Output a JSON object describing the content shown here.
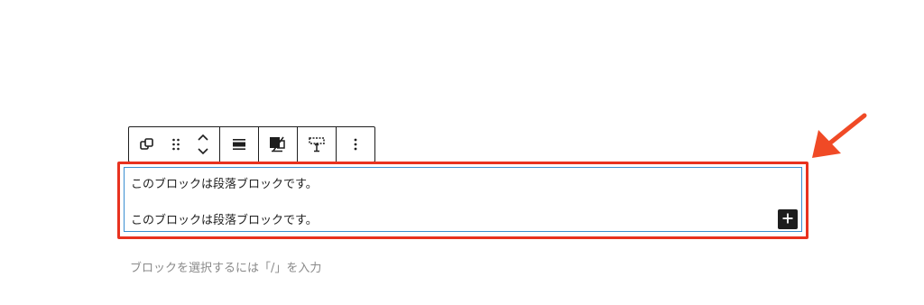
{
  "toolbar": {
    "buttons": [
      {
        "icon": "duplicate-block-icon"
      },
      {
        "icon": "drag-handle-icon"
      },
      {
        "icon": "move-up-icon"
      },
      {
        "icon": "move-down-icon"
      },
      {
        "icon": "align-icon"
      },
      {
        "icon": "text-color-icon"
      },
      {
        "icon": "spacing-icon"
      },
      {
        "icon": "more-options-icon"
      }
    ]
  },
  "block": {
    "paragraphs": [
      "このブロックは段落ブロックです。",
      "このブロックは段落ブロックです。"
    ]
  },
  "inserter": {
    "icon": "plus-icon"
  },
  "placeholder": "ブロックを選択するには「/」を入力",
  "colors": {
    "highlight": "#e8321f",
    "arrow": "#f04a26",
    "selection_border": "#3a8fd1",
    "text": "#1e1e1e",
    "placeholder": "#8a8a8a"
  }
}
